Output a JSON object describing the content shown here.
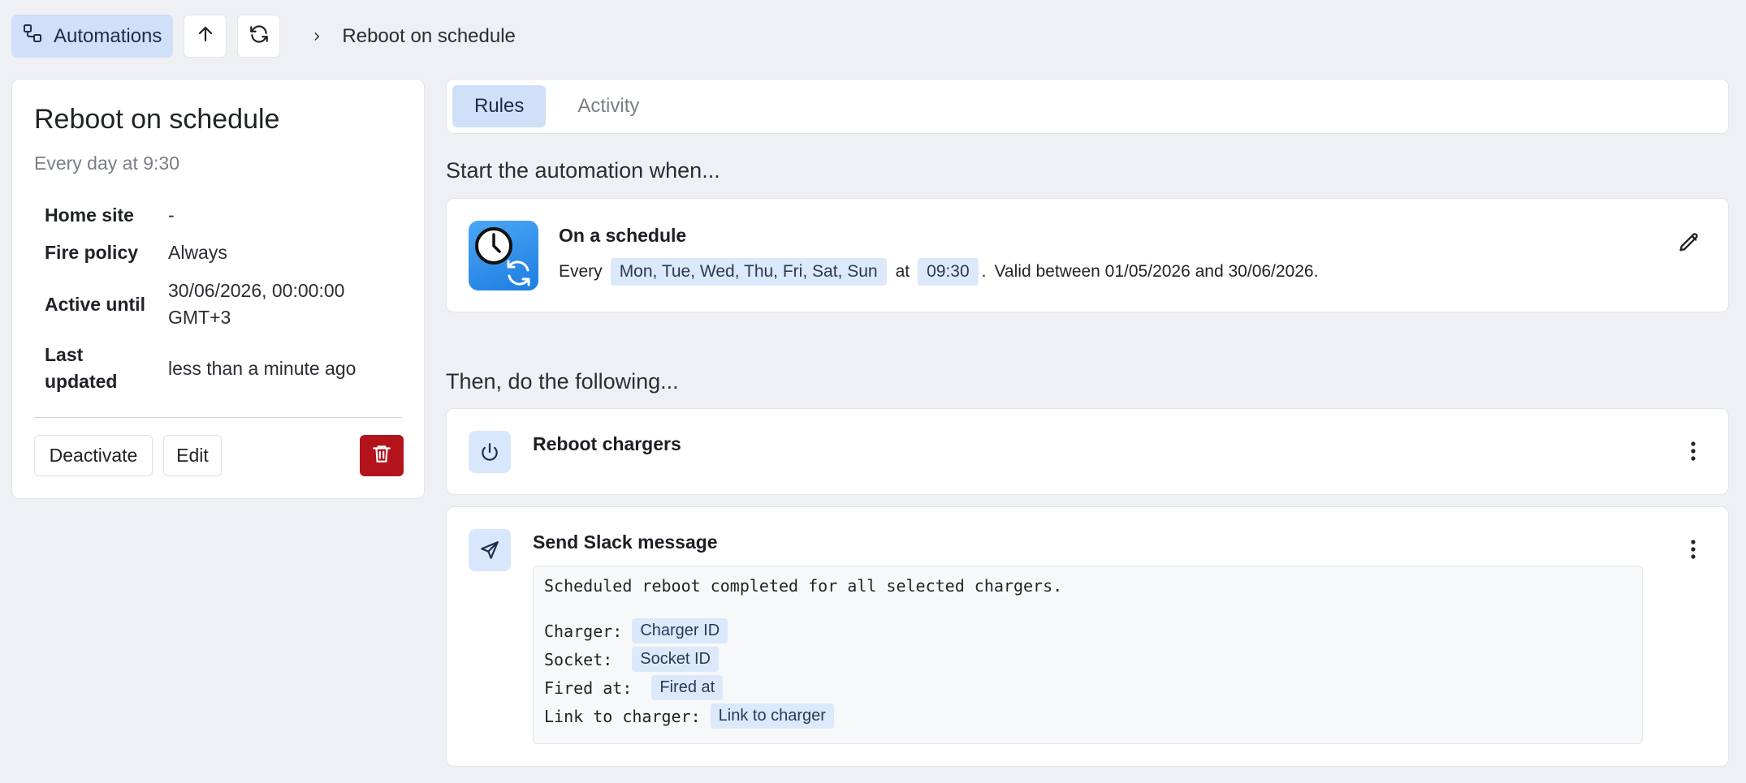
{
  "toolbar": {
    "automations_label": "Automations",
    "breadcrumb_current": "Reboot on schedule"
  },
  "sidebar": {
    "title": "Reboot on schedule",
    "subtitle": "Every day at 9:30",
    "properties": [
      {
        "label": "Home site",
        "value": "-"
      },
      {
        "label": "Fire policy",
        "value": "Always"
      },
      {
        "label": "Active until",
        "value_line1": "30/06/2026, 00:00:00",
        "value_line2": "GMT+3"
      },
      {
        "label_line1": "Last",
        "label_line2": "updated",
        "value": "less than a minute ago"
      }
    ],
    "deactivate_label": "Deactivate",
    "edit_label": "Edit"
  },
  "tabs": [
    {
      "label": "Rules",
      "active": true
    },
    {
      "label": "Activity",
      "active": false
    }
  ],
  "trigger_section": {
    "heading": "Start the automation when...",
    "title": "On a schedule",
    "every_text": "Every",
    "days_chip": "Mon, Tue, Wed, Thu, Fri, Sat, Sun",
    "at_text": "at",
    "time_chip": "09:30",
    "period_dot": ".",
    "valid_text": "Valid between 01/05/2026 and 30/06/2026."
  },
  "actions_section": {
    "heading": "Then, do the following...",
    "actions": [
      {
        "title": "Reboot chargers",
        "icon": "power-icon"
      },
      {
        "title": "Send Slack message",
        "icon": "send-icon",
        "message_intro": "Scheduled reboot completed for all selected chargers.",
        "fields": [
          {
            "label": "Charger:",
            "chip": "Charger ID"
          },
          {
            "label": "Socket:",
            "chip": "Socket ID"
          },
          {
            "label": "Fired at:",
            "chip": "Fired at"
          },
          {
            "label": "Link to charger:",
            "chip": "Link to charger"
          }
        ]
      }
    ]
  },
  "colors": {
    "background": "#eff0f4",
    "accent_soft": "#cfe0f8",
    "chip": "#dbe9fb",
    "danger": "#b3141b"
  }
}
